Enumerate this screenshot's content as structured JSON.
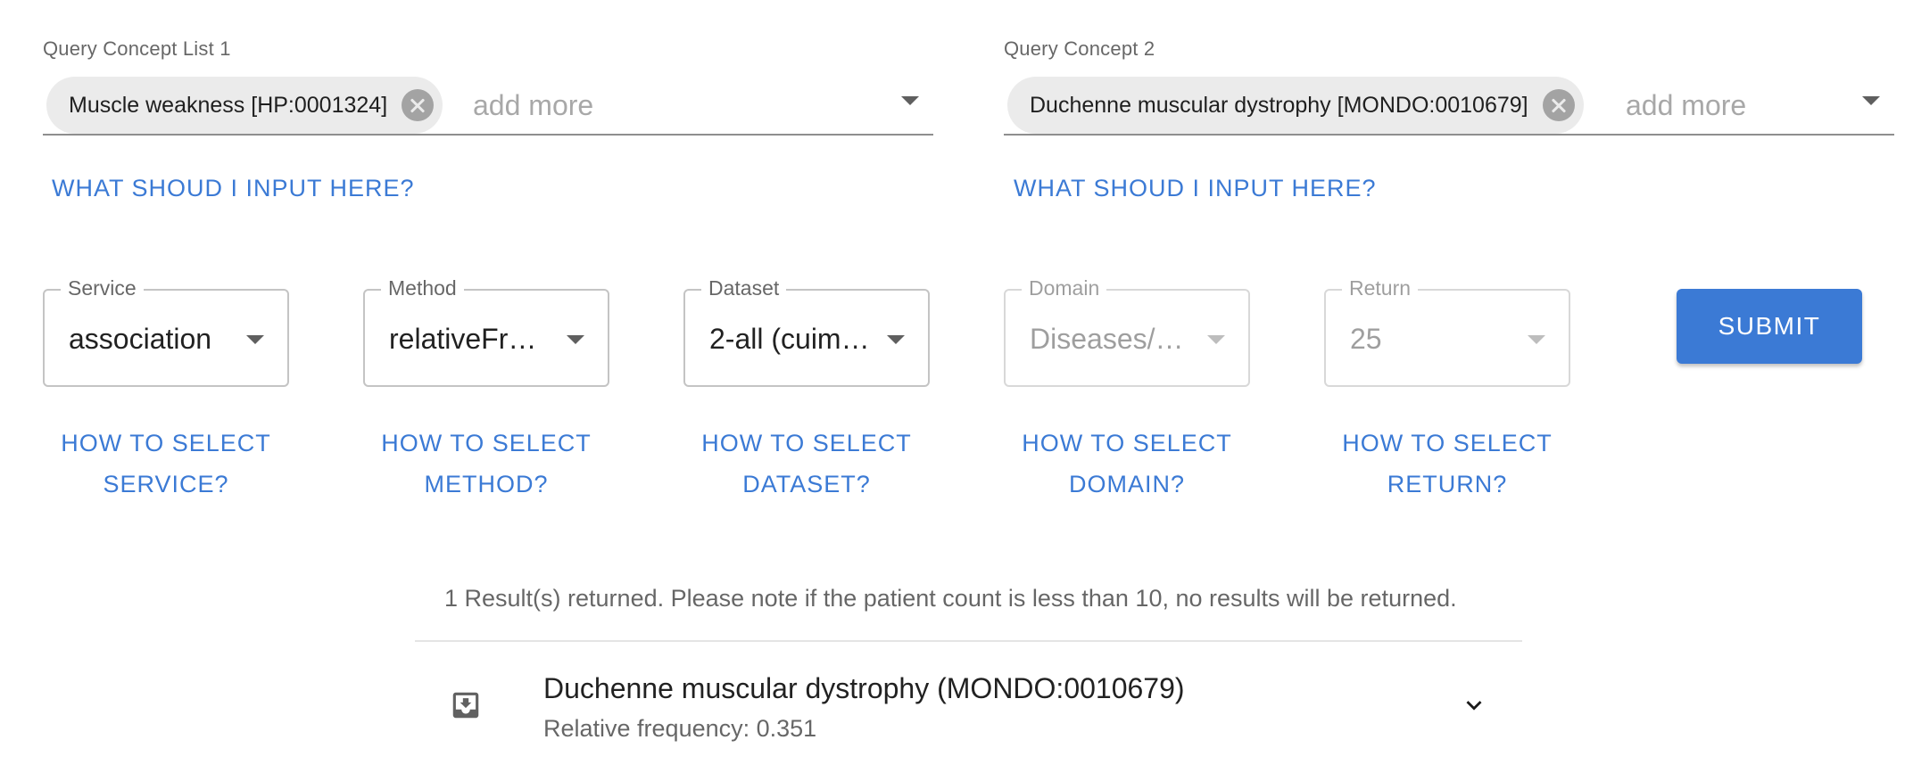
{
  "query1": {
    "label": "Query Concept List 1",
    "chip": "Muscle weakness [HP:0001324]",
    "placeholder": "add more",
    "help": "WHAT SHOUD I INPUT HERE?"
  },
  "query2": {
    "label": "Query Concept 2",
    "chip": "Duchenne muscular dystrophy [MONDO:0010679]",
    "placeholder": "add more",
    "help": "WHAT SHOUD I INPUT HERE?"
  },
  "selects": {
    "service": {
      "label": "Service",
      "value": "association",
      "help_line1": "HOW TO SELECT",
      "help_line2": "SERVICE?",
      "disabled": false
    },
    "method": {
      "label": "Method",
      "value": "relativeFre…",
      "help_line1": "HOW TO SELECT",
      "help_line2": "METHOD?",
      "disabled": false
    },
    "dataset": {
      "label": "Dataset",
      "value": "2-all (cuim…",
      "help_line1": "HOW TO SELECT",
      "help_line2": "DATASET?",
      "disabled": false
    },
    "domain": {
      "label": "Domain",
      "value": "Diseases/…",
      "help_line1": "HOW TO SELECT",
      "help_line2": "DOMAIN?",
      "disabled": true
    },
    "return": {
      "label": "Return",
      "value": "25",
      "help_line1": "HOW TO SELECT",
      "help_line2": "RETURN?",
      "disabled": true
    }
  },
  "submit_label": "SUBMIT",
  "results": {
    "note": "1 Result(s) returned. Please note if the patient count is less than 10, no results will be returned.",
    "items": [
      {
        "title": "Duchenne muscular dystrophy (MONDO:0010679)",
        "subtitle": "Relative frequency: 0.351"
      }
    ]
  },
  "icons": {
    "chip_delete": "cancel-icon",
    "dropdown": "arrow-drop-down-icon",
    "result": "move-to-inbox-icon",
    "expand": "expand-more-icon"
  },
  "colors": {
    "primary": "#3b7ad5",
    "chip_bg": "#ebebeb",
    "chip_delete": "#a3a3a3"
  }
}
